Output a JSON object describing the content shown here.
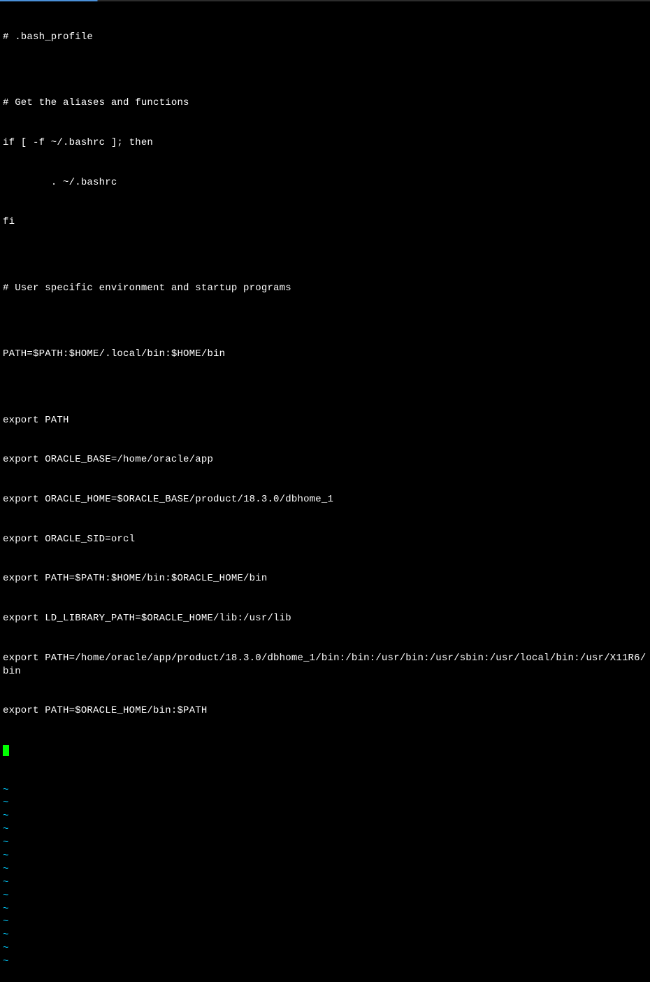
{
  "editor": {
    "lines": [
      "# .bash_profile",
      "",
      "# Get the aliases and functions",
      "if [ -f ~/.bashrc ]; then",
      "        . ~/.bashrc",
      "fi",
      "",
      "# User specific environment and startup programs",
      "",
      "PATH=$PATH:$HOME/.local/bin:$HOME/bin",
      "",
      "export PATH",
      "export ORACLE_BASE=/home/oracle/app",
      "export ORACLE_HOME=$ORACLE_BASE/product/18.3.0/dbhome_1",
      "export ORACLE_SID=orcl",
      "export PATH=$PATH:$HOME/bin:$ORACLE_HOME/bin",
      "export LD_LIBRARY_PATH=$ORACLE_HOME/lib:/usr/lib",
      "export PATH=/home/oracle/app/product/18.3.0/dbhome_1/bin:/bin:/usr/bin:/usr/sbin:/usr/local/bin:/usr/X11R6/bin",
      "export PATH=$ORACLE_HOME/bin:$PATH"
    ],
    "tilde": "~",
    "tildeCount": 14
  }
}
